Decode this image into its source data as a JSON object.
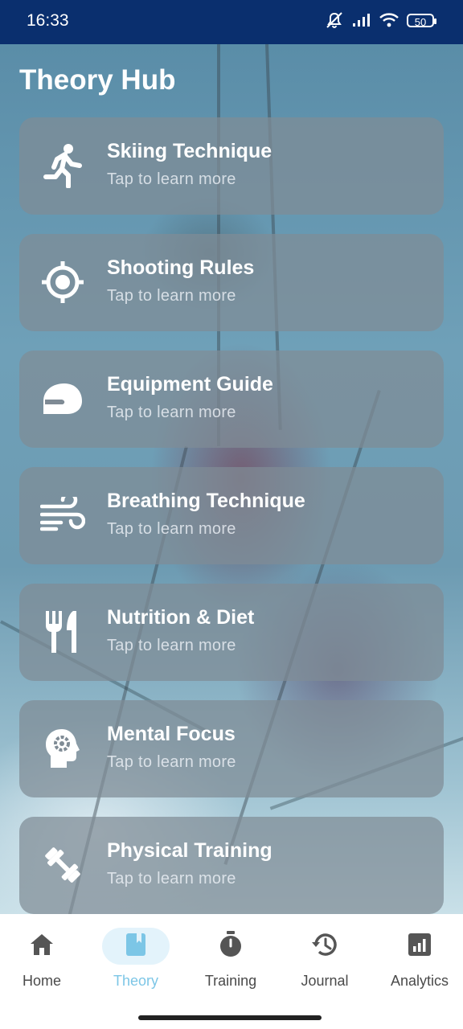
{
  "status": {
    "time": "16:33",
    "battery": "50"
  },
  "header": {
    "title": "Theory Hub"
  },
  "cards": [
    {
      "title": "Skiing Technique",
      "subtitle": "Tap to learn more",
      "icon": "running-icon"
    },
    {
      "title": "Shooting Rules",
      "subtitle": "Tap to learn more",
      "icon": "target-icon"
    },
    {
      "title": "Equipment Guide",
      "subtitle": "Tap to learn more",
      "icon": "helmet-icon"
    },
    {
      "title": "Breathing Technique",
      "subtitle": "Tap to learn more",
      "icon": "wind-icon"
    },
    {
      "title": "Nutrition & Diet",
      "subtitle": "Tap to learn more",
      "icon": "fork-knife-icon"
    },
    {
      "title": "Mental Focus",
      "subtitle": "Tap to learn more",
      "icon": "head-gear-icon"
    },
    {
      "title": "Physical Training",
      "subtitle": "Tap to learn more",
      "icon": "dumbbell-icon"
    }
  ],
  "nav": {
    "items": [
      {
        "label": "Home",
        "icon": "home-icon"
      },
      {
        "label": "Theory",
        "icon": "book-icon",
        "active": true
      },
      {
        "label": "Training",
        "icon": "stopwatch-icon"
      },
      {
        "label": "Journal",
        "icon": "history-icon"
      },
      {
        "label": "Analytics",
        "icon": "analytics-icon"
      }
    ]
  },
  "colors": {
    "statusbar": "#0a2f6e",
    "active": "#7cc6e6",
    "card": "#808c96"
  }
}
